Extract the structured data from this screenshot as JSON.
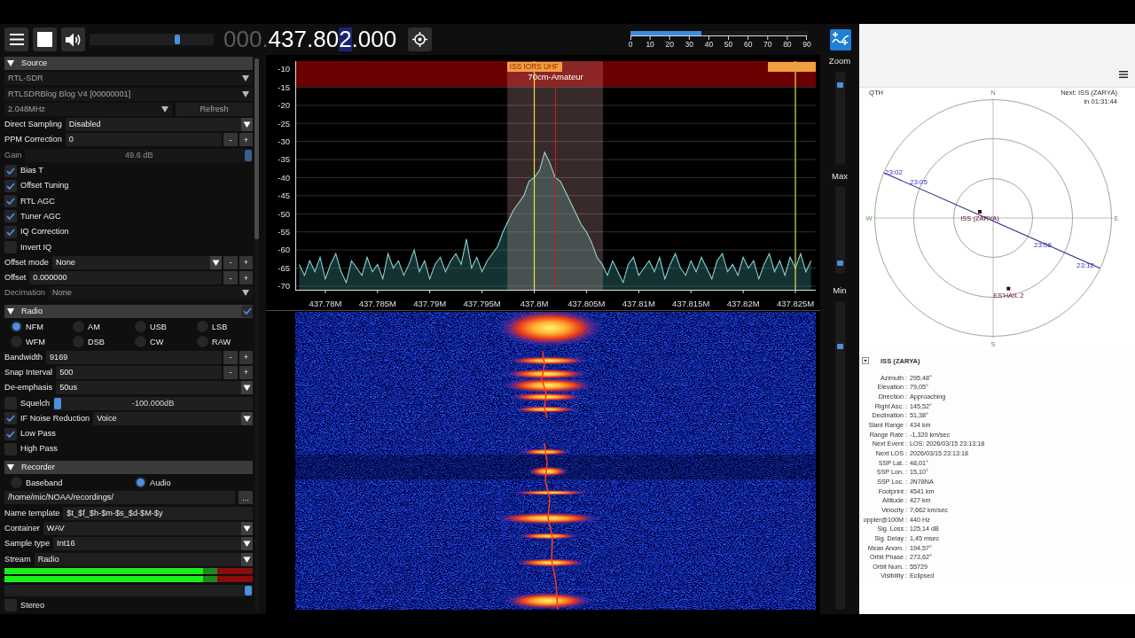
{
  "toolbar": {
    "playing": true,
    "volume": {
      "level": 0.72
    },
    "frequency": [
      {
        "text": "000.",
        "dim": true,
        "hovered": false
      },
      {
        "text": "437.80",
        "dim": false,
        "hovered": false
      },
      {
        "text": "2",
        "dim": false,
        "hovered": true
      },
      {
        "text": ".000",
        "dim": false,
        "hovered": false
      }
    ],
    "snr_meter": {
      "level": 0.4,
      "ticks": [
        "0",
        "10",
        "20",
        "30",
        "40",
        "50",
        "60",
        "70",
        "80",
        "90"
      ]
    }
  },
  "sidebar": {
    "sections": [
      {
        "title": "Source",
        "expanded": true,
        "rows": [
          {
            "kind": "select",
            "value": "RTL-SDR",
            "disabled": true
          },
          {
            "kind": "select",
            "value": "RTLSDRBlog Blog V4 [00000001]",
            "disabled": true
          },
          {
            "kind": "select_button",
            "value": "2.048MHz",
            "button": "Refresh",
            "disabled": true
          },
          {
            "kind": "select",
            "label": "Direct Sampling",
            "value": "Disabled",
            "disabled": false
          },
          {
            "kind": "stepper",
            "label": "PPM Correction",
            "value": "0",
            "buttons": [
              "-",
              "+"
            ],
            "disabled": false
          },
          {
            "kind": "slider",
            "label": "Gain",
            "reading": "49.6 dB",
            "level": 1,
            "disabled": true
          },
          {
            "kind": "checkbox",
            "label": "Bias T",
            "checked": true,
            "disabled": false
          },
          {
            "kind": "checkbox",
            "label": "Offset Tuning",
            "checked": true,
            "disabled": false
          },
          {
            "kind": "checkbox",
            "label": "RTL AGC",
            "checked": true,
            "disabled": false
          },
          {
            "kind": "checkbox",
            "label": "Tuner AGC",
            "checked": true,
            "disabled": false
          },
          {
            "kind": "checkbox",
            "label": "IQ Correction",
            "checked": true,
            "disabled": false
          },
          {
            "kind": "checkbox",
            "label": "Invert IQ",
            "checked": false,
            "disabled": false
          },
          {
            "kind": "select_stepper",
            "label": "Offset mode",
            "value": "None",
            "buttons": [
              "-",
              "+"
            ],
            "disabled": false
          },
          {
            "kind": "stepper",
            "label": "Offset",
            "value": "0.000000",
            "buttons": [
              "-",
              "+"
            ],
            "disabled": false
          },
          {
            "kind": "select",
            "label": "Decimation",
            "value": "None",
            "disabled": true
          }
        ]
      },
      {
        "title": "Radio",
        "expanded": true,
        "header_checkbox": true,
        "rows": [
          {
            "kind": "radio_group",
            "options": [
              {
                "label": "NFM",
                "selected": true
              },
              {
                "label": "AM",
                "selected": false
              },
              {
                "label": "USB",
                "selected": false
              },
              {
                "label": "LSB",
                "selected": false
              },
              {
                "label": "WFM",
                "selected": false
              },
              {
                "label": "DSB",
                "selected": false
              },
              {
                "label": "CW",
                "selected": false
              },
              {
                "label": "RAW",
                "selected": false
              }
            ],
            "disabled": false
          },
          {
            "kind": "stepper",
            "label": "Bandwidth",
            "value": "9169",
            "buttons": [
              "-",
              "+"
            ],
            "disabled": false
          },
          {
            "kind": "stepper",
            "label": "Snap Interval",
            "value": "500",
            "buttons": [
              "-",
              "+"
            ],
            "disabled": false
          },
          {
            "kind": "select",
            "label": "De-emphasis",
            "value": "50us",
            "disabled": false
          },
          {
            "kind": "check_slider",
            "label": "Squelch",
            "checked": false,
            "reading": "-100.000dB",
            "level": 0,
            "disabled": false
          },
          {
            "kind": "check_select",
            "label": "IF Noise Reduction",
            "checked": true,
            "value": "Voice",
            "disabled": false
          },
          {
            "kind": "checkbox",
            "label": "Low Pass",
            "checked": true,
            "disabled": false
          },
          {
            "kind": "checkbox",
            "label": "High Pass",
            "checked": false,
            "disabled": false
          }
        ]
      },
      {
        "title": "Recorder",
        "expanded": true,
        "rows": [
          {
            "kind": "radio_group",
            "options": [
              {
                "label": "Baseband",
                "selected": false
              },
              {
                "label": "Audio",
                "selected": true
              }
            ],
            "disabled": false
          },
          {
            "kind": "input_button",
            "value": "/home/mic/NOAA/recordings/",
            "button": "...",
            "disabled": false
          },
          {
            "kind": "input",
            "label": "Name template",
            "value": "$t_$f_$h-$m-$s_$d-$M-$y",
            "disabled": false
          },
          {
            "kind": "select",
            "label": "Container",
            "value": "WAV",
            "disabled": false
          },
          {
            "kind": "select",
            "label": "Sample type",
            "value": "Int16",
            "disabled": false
          },
          {
            "kind": "select",
            "label": "Stream",
            "value": "Radio",
            "disabled": false
          },
          {
            "kind": "meter",
            "level": 0.8,
            "disabled": false
          },
          {
            "kind": "meter",
            "level": 0.8,
            "disabled": false
          },
          {
            "kind": "slider",
            "level": 1,
            "disabled": false
          },
          {
            "kind": "checkbox",
            "label": "Stereo",
            "checked": false,
            "disabled": false
          }
        ]
      }
    ]
  },
  "spectrum": {
    "band_plan": {
      "label": "70cm-Amateur"
    },
    "chart_data": {
      "type": "line",
      "grid": true,
      "x": [
        437.7775,
        437.778,
        437.7785,
        437.779,
        437.7795,
        437.78,
        437.7805,
        437.781,
        437.7815,
        437.782,
        437.7825,
        437.783,
        437.7835,
        437.784,
        437.7845,
        437.785,
        437.7855,
        437.786,
        437.7865,
        437.787,
        437.7875,
        437.788,
        437.7885,
        437.789,
        437.7895,
        437.79,
        437.7905,
        437.791,
        437.7915,
        437.792,
        437.7925,
        437.793,
        437.7935,
        437.794,
        437.7945,
        437.795,
        437.7955,
        437.796,
        437.7965,
        437.797,
        437.7975,
        437.798,
        437.7985,
        437.799,
        437.7995,
        437.8,
        437.8005,
        437.801,
        437.8015,
        437.802,
        437.8025,
        437.803,
        437.8035,
        437.804,
        437.8045,
        437.805,
        437.8055,
        437.806,
        437.8065,
        437.807,
        437.8075,
        437.808,
        437.8085,
        437.809,
        437.8095,
        437.81,
        437.8105,
        437.811,
        437.8115,
        437.812,
        437.8125,
        437.813,
        437.8135,
        437.814,
        437.8145,
        437.815,
        437.8155,
        437.816,
        437.8165,
        437.817,
        437.8175,
        437.818,
        437.8185,
        437.819,
        437.8195,
        437.82,
        437.8205,
        437.821,
        437.8215,
        437.822,
        437.8225,
        437.823,
        437.8235,
        437.824,
        437.8245,
        437.825,
        437.8255,
        437.826,
        437.8265
      ],
      "series": [
        {
          "values": [
            -64,
            -67,
            -63,
            -66,
            -62,
            -68,
            -64,
            -61,
            -66,
            -69,
            -63,
            -65,
            -67,
            -62,
            -66,
            -64,
            -68,
            -61,
            -65,
            -63,
            -67,
            -64,
            -60,
            -66,
            -63,
            -68,
            -64,
            -62,
            -66,
            -63,
            -61,
            -64,
            -57,
            -65,
            -62,
            -66,
            -63,
            -61,
            -59,
            -55,
            -52,
            -49,
            -47,
            -45,
            -41,
            -40,
            -38,
            -33,
            -36,
            -40,
            -41,
            -44,
            -47,
            -50,
            -53,
            -55,
            -58,
            -62,
            -64,
            -67,
            -63,
            -66,
            -69,
            -64,
            -62,
            -67,
            -65,
            -63,
            -66,
            -62,
            -68,
            -64,
            -61,
            -65,
            -67,
            -63,
            -66,
            -62,
            -65,
            -68,
            -63,
            -61,
            -66,
            -64,
            -67,
            -62,
            -65,
            -63,
            -68,
            -64,
            -61,
            -66,
            -63,
            -67,
            -62,
            -65,
            -61,
            -66,
            -63
          ]
        }
      ],
      "xlim": [
        437.77712,
        437.82695
      ],
      "ylim": [
        -71,
        -7.8
      ],
      "xticks": [
        {
          "value": 437.78,
          "label": "437.78M"
        },
        {
          "value": 437.785,
          "label": "437.785M"
        },
        {
          "value": 437.79,
          "label": "437.79M"
        },
        {
          "value": 437.795,
          "label": "437.795M"
        },
        {
          "value": 437.8,
          "label": "437.8M"
        },
        {
          "value": 437.805,
          "label": "437.805M"
        },
        {
          "value": 437.81,
          "label": "437.81M"
        },
        {
          "value": 437.815,
          "label": "437.815M"
        },
        {
          "value": 437.82,
          "label": "437.82M"
        },
        {
          "value": 437.825,
          "label": "437.825M"
        }
      ],
      "yticks": [
        -10,
        -15,
        -20,
        -25,
        -30,
        -35,
        -40,
        -45,
        -50,
        -55,
        -60,
        -65,
        -70
      ],
      "bands": [
        {
          "axis": "x",
          "from": 437.79742,
          "to": 437.80658
        }
      ],
      "ref_lines": [
        {
          "axis": "x",
          "value": 437.8,
          "label": "ISS IORS UHF"
        },
        {
          "axis": "x",
          "value": 437.825
        }
      ]
    }
  },
  "display_controls": [
    {
      "label": "Zoom",
      "level": 0.88
    },
    {
      "label": "Max",
      "level": 0.1
    },
    {
      "label": "Min",
      "level": 0.86
    }
  ],
  "tracker": {
    "polar_view": {
      "qth_label": "QTH",
      "next_pass": "Next: ISS (ZARYA)",
      "countdown": "in 01:31:44",
      "compass": {
        "north": "N",
        "east": "E",
        "south": "S",
        "west": "W"
      },
      "track_times": [
        "23:02",
        "23:05",
        "23:08",
        "23:12"
      ],
      "satellites": [
        {
          "name": "ISS (ZARYA)"
        },
        {
          "name": "ES'HAIL 2"
        }
      ]
    },
    "satellite_info": {
      "title": "ISS (ZARYA)",
      "expanded": true,
      "rows": [
        {
          "label": "Azimuth",
          "separator": ":",
          "value": "295,48°"
        },
        {
          "label": "Elevation",
          "separator": ":",
          "value": "79,05°"
        },
        {
          "label": "Direction",
          "separator": ":",
          "value": "Approaching"
        },
        {
          "label": "Right Asc.",
          "separator": ":",
          "value": "145,52°"
        },
        {
          "label": "Declination",
          "separator": ":",
          "value": "51,38°"
        },
        {
          "label": "Slant Range",
          "separator": ":",
          "value": "434 km"
        },
        {
          "label": "Range Rate",
          "separator": ":",
          "value": "-1,320 km/sec"
        },
        {
          "label": "Next Event",
          "separator": ":",
          "value": "LOS: 2026/03/15 23:13:18"
        },
        {
          "label": "Next LOS",
          "separator": ":",
          "value": "2026/03/15 23:13:18"
        },
        {
          "label": "SSP Lat.",
          "separator": ":",
          "value": "48,01°"
        },
        {
          "label": "SSP Lon.",
          "separator": ":",
          "value": "15,10°"
        },
        {
          "label": "SSP Loc.",
          "separator": ":",
          "value": "JN78NA"
        },
        {
          "label": "Footprint",
          "separator": ":",
          "value": "4541 km"
        },
        {
          "label": "Altitude",
          "separator": ":",
          "value": "427 km"
        },
        {
          "label": "Velocity",
          "separator": ":",
          "value": "7,662 km/sec"
        },
        {
          "label": "oppler@100M",
          "separator": ":",
          "value": "440 Hz"
        },
        {
          "label": "Sig. Loss",
          "separator": ":",
          "value": "125,14 dB"
        },
        {
          "label": "Sig. Delay",
          "separator": ":",
          "value": "1,45 msec"
        },
        {
          "label": "Mean Anom.",
          "separator": ":",
          "value": "194,57°"
        },
        {
          "label": "Orbit Phase",
          "separator": ":",
          "value": "273,62°"
        },
        {
          "label": "Orbit Num.",
          "separator": ":",
          "value": "55729"
        },
        {
          "label": "Visibility",
          "separator": ":",
          "value": "Eclipsed"
        }
      ]
    }
  }
}
